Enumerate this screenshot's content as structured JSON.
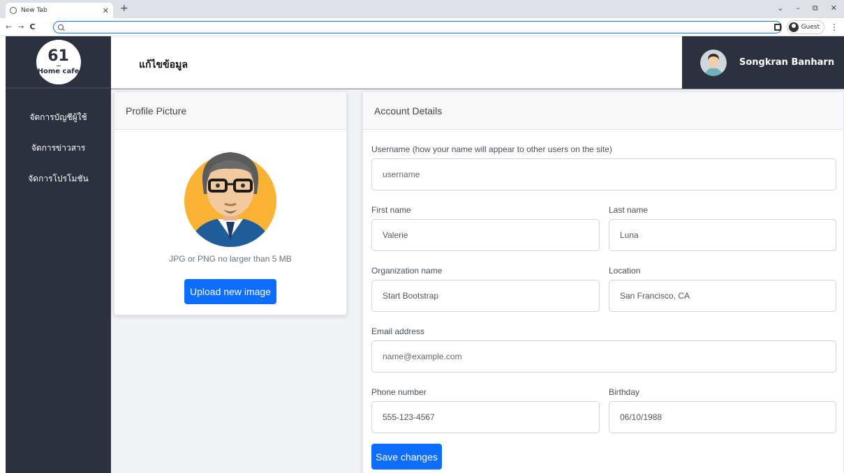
{
  "browser": {
    "tab_title": "New Tab",
    "guest_label": "Guest"
  },
  "sidebar": {
    "logo_number": "61",
    "logo_text": "Home cafe",
    "items": [
      {
        "label": "จัดการบัญชีผู้ใช้"
      },
      {
        "label": "จัดการข่าวสาร"
      },
      {
        "label": "จัดการโปรโมชัน"
      }
    ]
  },
  "header": {
    "title": "แก้ไขข้อมูล",
    "user_name": "Songkran Banharn"
  },
  "profile_card": {
    "title": "Profile Picture",
    "hint": "JPG or PNG no larger than 5 MB",
    "upload_label": "Upload new image"
  },
  "account_card": {
    "title": "Account Details",
    "username_label": "Username (how your name will appear to other users on the site)",
    "username_placeholder": "username",
    "first_name_label": "First name",
    "first_name_value": "Valerie",
    "last_name_label": "Last name",
    "last_name_value": "Luna",
    "org_label": "Organization name",
    "org_value": "Start Bootstrap",
    "location_label": "Location",
    "location_value": "San Francisco, CA",
    "email_label": "Email address",
    "email_placeholder": "name@example.com",
    "phone_label": "Phone number",
    "phone_value": "555-123-4567",
    "birthday_label": "Birthday",
    "birthday_value": "06/10/1988",
    "save_label": "Save changes"
  },
  "colors": {
    "sidebar_bg": "#2b313e",
    "primary": "#0d6efd",
    "page_bg": "#f0f2f6"
  }
}
